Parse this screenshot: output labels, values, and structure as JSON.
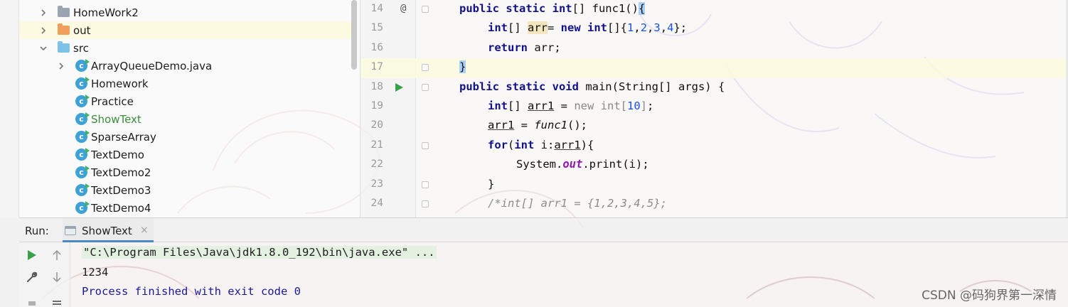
{
  "project_tree": {
    "items": [
      {
        "label": "HomeWork2",
        "icon": "folder-gray",
        "expander": "collapsed"
      },
      {
        "label": "out",
        "icon": "folder-orange",
        "expander": "collapsed",
        "selected": true
      },
      {
        "label": "src",
        "icon": "folder-blue",
        "expander": "expanded"
      },
      {
        "label": "ArrayQueueDemo.java",
        "icon": "java-class-icon",
        "expander": "collapsed"
      },
      {
        "label": "Homework",
        "icon": "java-class-icon"
      },
      {
        "label": "Practice",
        "icon": "java-class-icon"
      },
      {
        "label": "ShowText",
        "icon": "java-class-icon",
        "modified": true
      },
      {
        "label": "SparseArray",
        "icon": "java-class-icon"
      },
      {
        "label": "TextDemo",
        "icon": "java-class-icon"
      },
      {
        "label": "TextDemo2",
        "icon": "java-class-icon"
      },
      {
        "label": "TextDemo3",
        "icon": "java-class-icon"
      },
      {
        "label": "TextDemo4",
        "icon": "java-class-icon"
      }
    ]
  },
  "editor": {
    "lines": [
      {
        "num": "14",
        "marker": "@",
        "code": "public static int[] func1(){"
      },
      {
        "num": "15",
        "code": "int[] arr= new int[]{1,2,3,4};"
      },
      {
        "num": "16",
        "code": "return arr;"
      },
      {
        "num": "17",
        "code": "}"
      },
      {
        "num": "18",
        "code": "public static void main(String[] args) {"
      },
      {
        "num": "19",
        "code": "int[] arr1 = new int[10];"
      },
      {
        "num": "20",
        "code": "arr1 = func1();"
      },
      {
        "num": "21",
        "code": "for(int i:arr1){"
      },
      {
        "num": "22",
        "code": "System.out.print(i);"
      },
      {
        "num": "23",
        "code": "}"
      },
      {
        "num": "24",
        "code": "/*int[] arr1 = {1,2,3,4,5};"
      }
    ]
  },
  "run_panel": {
    "title": "Run:",
    "tab_label": "ShowText",
    "tab_close": "×",
    "console": {
      "command": "\"C:\\Program Files\\Java\\jdk1.8.0_192\\bin\\java.exe\" ...",
      "output": "1234",
      "exit": "Process finished with exit code 0"
    }
  },
  "watermark": "CSDN @码狗界第一深情",
  "colors": {
    "keyword": "#10128a",
    "number": "#1750eb",
    "run_green": "#3aa04a",
    "tab_underline": "#4a88c7"
  }
}
